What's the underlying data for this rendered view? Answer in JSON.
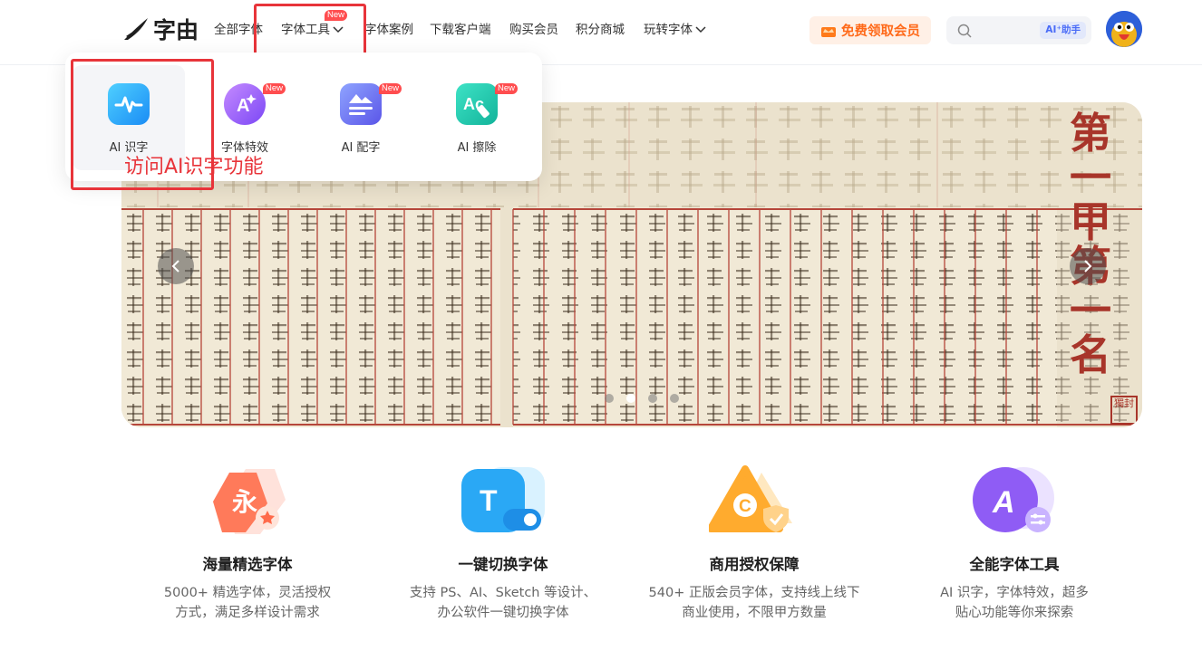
{
  "header": {
    "logo_text": "字由",
    "nav": [
      {
        "label": "全部字体"
      },
      {
        "label": "字体工具",
        "new": "New"
      },
      {
        "label": "字体案例"
      },
      {
        "label": "下载客户端"
      },
      {
        "label": "购买会员"
      },
      {
        "label": "积分商城"
      },
      {
        "label": "玩转字体"
      }
    ],
    "vip_button": "免费领取会员",
    "search_placeholder": "",
    "ai_helper": "AI⁺助手"
  },
  "dropdown": {
    "tools": [
      {
        "label": "AI 识字",
        "icon": "ai-recognize-icon",
        "new": ""
      },
      {
        "label": "字体特效",
        "icon": "font-effect-icon",
        "new": "New"
      },
      {
        "label": "AI 配字",
        "icon": "ai-caption-icon",
        "new": "New"
      },
      {
        "label": "AI 擦除",
        "icon": "ai-erase-icon",
        "new": "New"
      }
    ]
  },
  "annotation": "访问AI识字功能",
  "banner": {
    "slides": 4,
    "active_slide": 2,
    "headline": "第一甲第一名",
    "seal": "獨封"
  },
  "features": [
    {
      "title": "海量精选字体",
      "desc1": "5000+ 精选字体，灵活授权",
      "desc2": "方式，满足多样设计需求",
      "icon": "font-library-icon"
    },
    {
      "title": "一键切换字体",
      "desc1": "支持 PS、AI、Sketch 等设计、",
      "desc2": "办公软件一键切换字体",
      "icon": "font-switch-icon"
    },
    {
      "title": "商用授权保障",
      "desc1": "540+ 正版会员字体，支持线上线下",
      "desc2": "商业使用，不限甲方数量",
      "icon": "commercial-license-icon"
    },
    {
      "title": "全能字体工具",
      "desc1": "AI 识字，字体特效，超多",
      "desc2": "贴心功能等你来探索",
      "icon": "font-tools-icon"
    }
  ],
  "colors": {
    "accent_red": "#e8343a",
    "vip_orange": "#ff6a1a",
    "new_tag": "#ff4d4f"
  }
}
